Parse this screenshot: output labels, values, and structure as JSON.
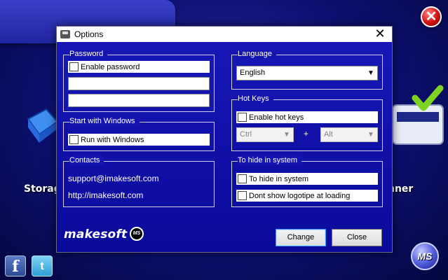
{
  "dialog": {
    "title": "Options",
    "close_glyph": "✕",
    "password": {
      "legend": "Password",
      "enable_label": "Enable password",
      "field1_value": "",
      "field2_value": ""
    },
    "startup": {
      "legend": "Start with Windows",
      "run_label": "Run with Windows"
    },
    "contacts": {
      "legend": "Contacts",
      "email": "support@imakesoft.com",
      "website": "http://imakesoft.com"
    },
    "language": {
      "legend": "Language",
      "selected": "English"
    },
    "hotkeys": {
      "legend": "Hot Keys",
      "enable_label": "Enable hot keys",
      "modifier1": "Ctrl",
      "plus": "+",
      "modifier2": "Alt"
    },
    "hide": {
      "legend": "To hide in system",
      "hide_label": "To hide in system",
      "logo_label": "Dont show logotipe at loading"
    },
    "buttons": {
      "change": "Change",
      "close": "Close"
    },
    "brand": {
      "name": "makesoft",
      "badge": "MS"
    }
  },
  "background": {
    "close_glyph": "✕",
    "left_label": "Storag",
    "right_label": "nner",
    "facebook_glyph": "f",
    "twitter_glyph": "t",
    "logo_text": "MS"
  },
  "icons": {
    "dropdown": "chevron-down-icon",
    "checkbox": "checkbox-icon"
  }
}
